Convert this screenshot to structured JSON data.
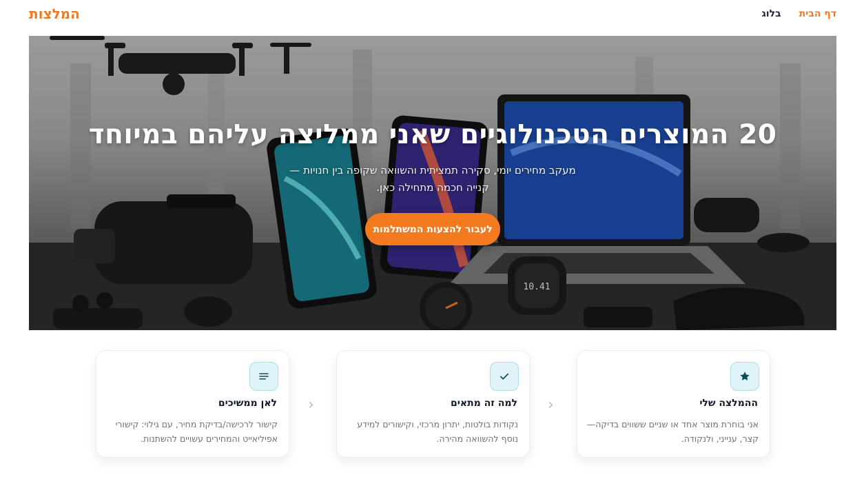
{
  "brand": "המלצות",
  "nav": {
    "home": "דף הבית",
    "blog": "בלוג"
  },
  "hero": {
    "title": "20 המוצרים הטכנולוגיים שאני ממליצה עליהם במיוחד",
    "subtitle_line1": "מעקב מחירים יומי, סקירה תמציתית והשוואה שקופה בין חנויות —",
    "subtitle_line2": "קנייה חכמה מתחילה כאן.",
    "cta_label": "לעבור להצעות המשתלמות",
    "watch_display": "10.41"
  },
  "steps": [
    {
      "icon": "star-icon",
      "title": "ההמלצה שלי",
      "text": "אני בוחרת מוצר אחד או שניים ששווים בדיקה—קצר, ענייני, ולנקודה."
    },
    {
      "icon": "check-icon",
      "title": "למה זה מתאים",
      "text": "נקודות בולטות, יתרון מרכזי, וקישורים למידע נוסף להשוואה מהירה."
    },
    {
      "icon": "list-icon",
      "title": "לאן ממשיכים",
      "text": "קישור לרכישה/בדיקת מחיר, עם גילוי: קישורי אפיליאייט והמחירים עשויים להשתנות."
    }
  ],
  "colors": {
    "accent": "#f07a23",
    "icon_bg": "#dff3f8"
  }
}
